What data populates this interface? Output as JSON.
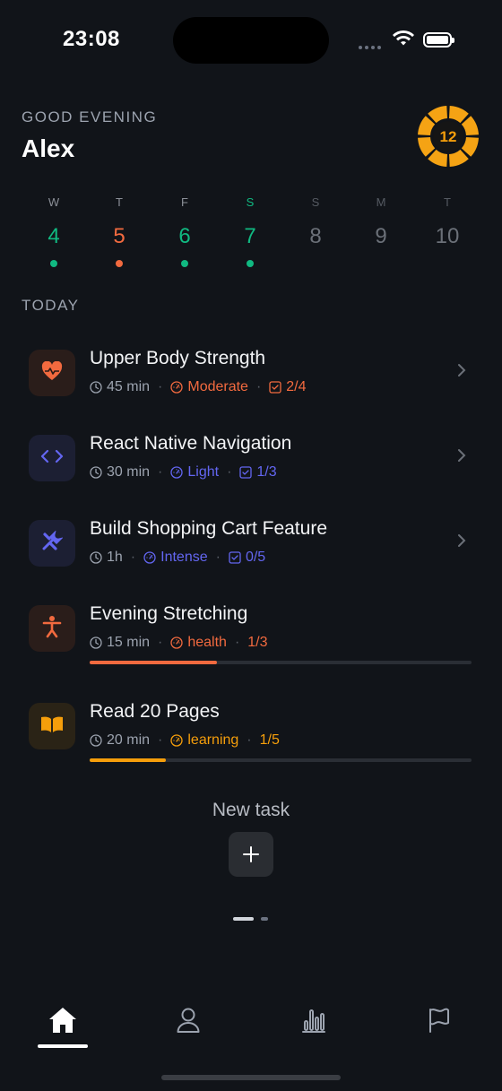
{
  "status_bar": {
    "time": "23:08"
  },
  "header": {
    "greeting": "GOOD EVENING",
    "user_name": "Alex",
    "level": "12"
  },
  "days": [
    {
      "letter": "W",
      "number": "4",
      "color": "#10b981",
      "dot": true,
      "letter_color": "#8b8f97"
    },
    {
      "letter": "T",
      "number": "5",
      "color": "#f26a3f",
      "dot": true,
      "letter_color": "#8b8f97"
    },
    {
      "letter": "F",
      "number": "6",
      "color": "#10b981",
      "dot": true,
      "letter_color": "#8b8f97"
    },
    {
      "letter": "S",
      "number": "7",
      "color": "#10b981",
      "dot": true,
      "letter_color": "#10b981"
    },
    {
      "letter": "S",
      "number": "8",
      "color": "#6b7078",
      "dot": false,
      "letter_color": "#555a62"
    },
    {
      "letter": "M",
      "number": "9",
      "color": "#6b7078",
      "dot": false,
      "letter_color": "#555a62"
    },
    {
      "letter": "T",
      "number": "10",
      "color": "#6b7078",
      "dot": false,
      "letter_color": "#555a62"
    }
  ],
  "section_label": "TODAY",
  "tasks": [
    {
      "title": "Upper Body Strength",
      "duration": "45 min",
      "level": "Moderate",
      "progress_text": "2/4",
      "icon": "heart-pulse-icon",
      "accent": "#f26a3f"
    },
    {
      "title": "React Native Navigation",
      "duration": "30 min",
      "level": "Light",
      "progress_text": "1/3",
      "icon": "code-icon",
      "accent": "#6366f1"
    },
    {
      "title": "Build Shopping Cart Feature",
      "duration": "1h",
      "level": "Intense",
      "progress_text": "0/5",
      "icon": "tools-icon",
      "accent": "#6366f1"
    },
    {
      "title": "Evening Stretching",
      "duration": "15 min",
      "level": "health",
      "progress_text": "1/3",
      "progress": 0.333,
      "icon": "person-icon",
      "accent": "#f26a3f"
    },
    {
      "title": "Read 20 Pages",
      "duration": "20 min",
      "level": "learning",
      "progress_text": "1/5",
      "progress": 0.2,
      "icon": "book-icon",
      "accent": "#f59e0b"
    }
  ],
  "new_task": {
    "label": "New task"
  },
  "tab_bar": {
    "items": [
      "home-icon",
      "profile-icon",
      "stats-icon",
      "flag-icon"
    ],
    "active": 0
  }
}
